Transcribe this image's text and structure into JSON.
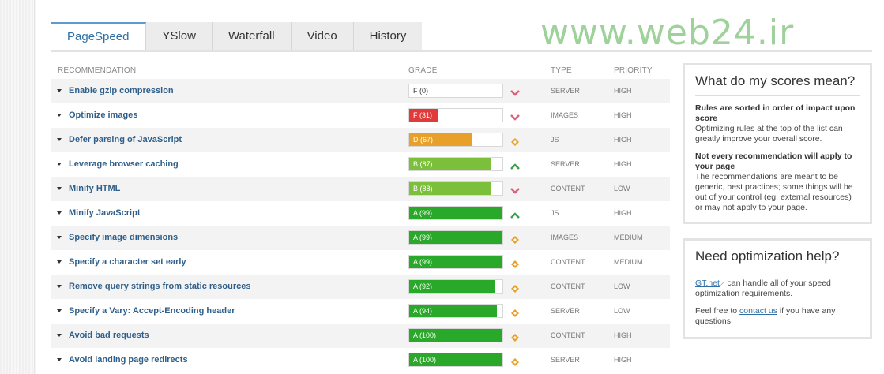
{
  "watermark": "www.web24.ir",
  "tabs": [
    {
      "label": "PageSpeed",
      "active": true
    },
    {
      "label": "YSlow"
    },
    {
      "label": "Waterfall"
    },
    {
      "label": "Video"
    },
    {
      "label": "History"
    }
  ],
  "columns": {
    "recommendation": "RECOMMENDATION",
    "grade": "GRADE",
    "type": "TYPE",
    "priority": "PRIORITY"
  },
  "colors": {
    "red": "#e03a3a",
    "orange": "#e8a02a",
    "lightgreen": "#7cbf3a",
    "green": "#2aa82a",
    "arrow_down": "#d9607a",
    "arrow_up": "#3a9e4a",
    "diamond": "#e8a02a"
  },
  "rows": [
    {
      "name": "Enable gzip compression",
      "grade": "F (0)",
      "score": 0,
      "trend": "down-icon",
      "type": "SERVER",
      "priority": "HIGH"
    },
    {
      "name": "Optimize images",
      "grade": "F (31)",
      "score": 31,
      "trend": "down-icon",
      "type": "IMAGES",
      "priority": "HIGH"
    },
    {
      "name": "Defer parsing of JavaScript",
      "grade": "D (67)",
      "score": 67,
      "trend": "diamond-icon",
      "type": "JS",
      "priority": "HIGH"
    },
    {
      "name": "Leverage browser caching",
      "grade": "B (87)",
      "score": 87,
      "trend": "up-icon",
      "type": "SERVER",
      "priority": "HIGH"
    },
    {
      "name": "Minify HTML",
      "grade": "B (88)",
      "score": 88,
      "trend": "down-icon",
      "type": "CONTENT",
      "priority": "LOW"
    },
    {
      "name": "Minify JavaScript",
      "grade": "A (99)",
      "score": 99,
      "trend": "up-icon",
      "type": "JS",
      "priority": "HIGH"
    },
    {
      "name": "Specify image dimensions",
      "grade": "A (99)",
      "score": 99,
      "trend": "diamond-icon",
      "type": "IMAGES",
      "priority": "MEDIUM"
    },
    {
      "name": "Specify a character set early",
      "grade": "A (99)",
      "score": 99,
      "trend": "diamond-icon",
      "type": "CONTENT",
      "priority": "MEDIUM"
    },
    {
      "name": "Remove query strings from static resources",
      "grade": "A (92)",
      "score": 92,
      "trend": "diamond-icon",
      "type": "CONTENT",
      "priority": "LOW"
    },
    {
      "name": "Specify a Vary: Accept-Encoding header",
      "grade": "A (94)",
      "score": 94,
      "trend": "diamond-icon",
      "type": "SERVER",
      "priority": "LOW"
    },
    {
      "name": "Avoid bad requests",
      "grade": "A (100)",
      "score": 100,
      "trend": "diamond-icon",
      "type": "CONTENT",
      "priority": "HIGH"
    },
    {
      "name": "Avoid landing page redirects",
      "grade": "A (100)",
      "score": 100,
      "trend": "diamond-icon",
      "type": "SERVER",
      "priority": "HIGH"
    }
  ],
  "scores_panel": {
    "title": "What do my scores mean?",
    "p1_bold": "Rules are sorted in order of impact upon score",
    "p1_text": "Optimizing rules at the top of the list can greatly improve your overall score.",
    "p2_bold": "Not every recommendation will apply to your page",
    "p2_text": "The recommendations are meant to be generic, best practices; some things will be out of your control (eg. external resources) or may not apply to your page."
  },
  "help_panel": {
    "title": "Need optimization help?",
    "link1": "GT.net",
    "text1": " can handle all of your speed optimization requirements.",
    "text2a": "Feel free to ",
    "link2": "contact us",
    "text2b": " if you have any questions."
  }
}
